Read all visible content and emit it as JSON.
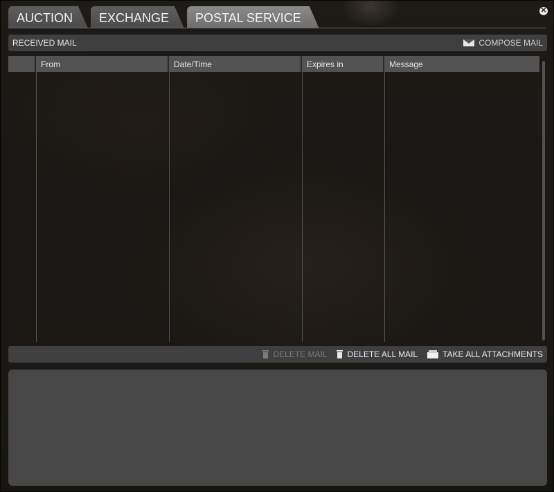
{
  "tabs": [
    {
      "label": "AUCTION"
    },
    {
      "label": "EXCHANGE"
    },
    {
      "label": "POSTAL SERVICE"
    }
  ],
  "received": {
    "title": "RECEIVED MAIL",
    "compose_label": "COMPOSE MAIL"
  },
  "table": {
    "columns": [
      {
        "label": ""
      },
      {
        "label": "From"
      },
      {
        "label": "Date/Time"
      },
      {
        "label": "Expires in"
      },
      {
        "label": "Message"
      }
    ],
    "rows": []
  },
  "actions": {
    "delete_mail": "DELETE MAIL",
    "delete_all_mail": "DELETE ALL MAIL",
    "take_all": "TAKE ALL ATTACHMENTS"
  },
  "icons": {
    "close": "close-icon",
    "compose": "envelope-icon",
    "trash": "trash-icon",
    "attachments": "box-icon"
  },
  "colors": {
    "panel": "#474747",
    "tab_active": "#8a8a8a",
    "tab_inactive": "#555555",
    "disabled_text": "#7a7a7a"
  }
}
